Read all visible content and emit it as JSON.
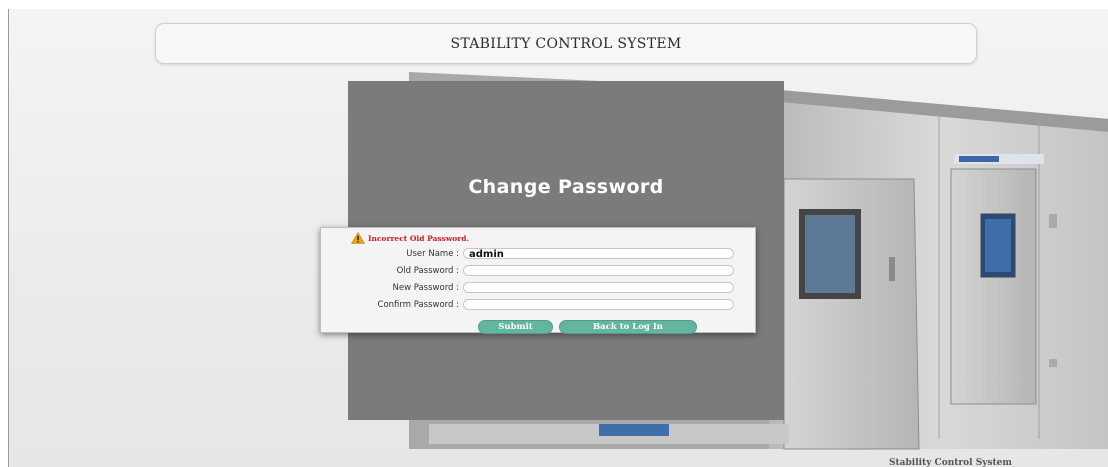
{
  "header": {
    "title": "STABILITY CONTROL SYSTEM"
  },
  "panel": {
    "title": "Change Password"
  },
  "form": {
    "error_message": "Incorrect Old Password.",
    "fields": [
      {
        "label": "User Name :",
        "value": "admin",
        "placeholder": ""
      },
      {
        "label": "Old Password :",
        "value": "",
        "placeholder": ""
      },
      {
        "label": "New Password :",
        "value": "",
        "placeholder": ""
      },
      {
        "label": "Confirm Password :",
        "value": "",
        "placeholder": ""
      }
    ],
    "buttons": {
      "submit": "Submit",
      "back": "Back to Log In"
    }
  },
  "footer": {
    "text": "Stability Control System"
  },
  "colors": {
    "panel": "#7b7b7b",
    "button": "#64b59f",
    "error": "#d11b1b"
  },
  "icons": {
    "error": "warning-icon"
  }
}
